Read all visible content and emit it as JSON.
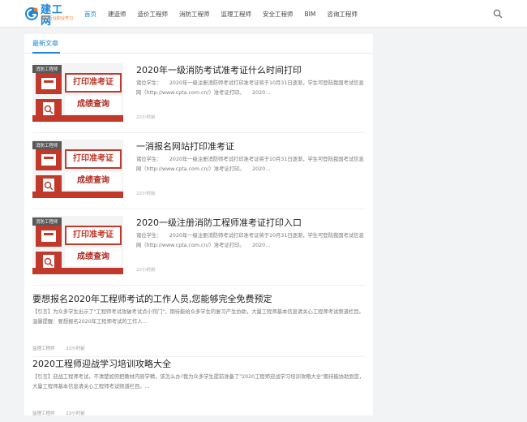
{
  "site": {
    "logo_title": "建工网",
    "logo_subtitle": "建工行业职业学习"
  },
  "nav": {
    "items": [
      {
        "label": "首页",
        "active": true
      },
      {
        "label": "建造师",
        "active": false
      },
      {
        "label": "造价工程师",
        "active": false
      },
      {
        "label": "消防工程师",
        "active": false
      },
      {
        "label": "监理工程师",
        "active": false
      },
      {
        "label": "安全工程师",
        "active": false
      },
      {
        "label": "BIM",
        "active": false
      },
      {
        "label": "咨询工程师",
        "active": false
      }
    ],
    "search_icon": "search-icon"
  },
  "section": {
    "title": "最新文章"
  },
  "articles": [
    {
      "title": "2020年一级消防考试准考证什么时间打印",
      "thumb_tag": "消防工程师",
      "thumb_banner": "打印准考证",
      "thumb_bar": "成绩查询",
      "excerpt": "诸位学生：　　2020年一级注册消防师考试打印准考证将于10月31日逐渐，学生可登陆我国考试信息网（http://www.cpta.com.cn/）准考证打印。　　2020…",
      "time": "22小时前"
    },
    {
      "title": "一消报名网站打印准考证",
      "thumb_tag": "消防工程师",
      "thumb_banner": "打印准考证",
      "thumb_bar": "成绩查询",
      "excerpt": "诸位学生：　　2020年一级注册消防师考试打印准考证将于10月31日逐渐，学生可登陆我国考试信息网（http://www.cpta.com.cn/）准考证打印。　　2020…",
      "time": "22小时前"
    },
    {
      "title": "2020一级注册消防工程师准考证打印入口",
      "thumb_tag": "消防工程师",
      "thumb_banner": "打印准考证",
      "thumb_bar": "成绩查询",
      "excerpt": "诸位学生：　　2020年一级注册消防师考试打印准考证将于10月31日逐渐，学生可登陆我国考试信息网（http://www.cpta.com.cn/）准考证打印。　　2020…",
      "time": "22小时前"
    },
    {
      "title": "要想报名2020年工程师考试的工作人员,您能够完全免费预定",
      "excerpt": "【引言】为众多学生出示了\"工程师考试攻破考试点小窍门\"，期待能给众多学生的复习产生协助，大量工程师基本信息请关心工程师考试频道栏目。 温馨提醒：要想报名2020年工程师考试的工作人…",
      "category": "监理工程师",
      "time": "22小时前"
    },
    {
      "title": "2020工程师迎战学习培训攻略大全",
      "excerpt": "【引言】迎战工程师考试，不清楚如何把教材内容学精，该怎么办?我为众多学生提前准备了\"2020工程师迎战学习培训攻略大全\"期待能协助到您，大量工程师基本信息请关心工程师考试频道栏目。…",
      "category": "监理工程师",
      "time": "22小时前"
    }
  ]
}
